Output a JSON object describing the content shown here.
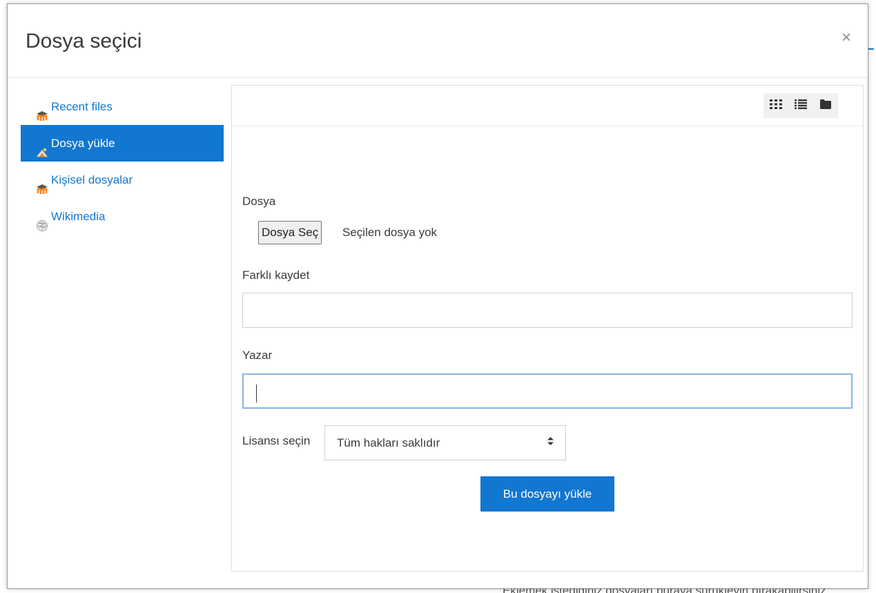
{
  "background": {
    "footer_text": "Eklemek istediğiniz dosyaları buraya sürükleyin bırakabilirsiniz"
  },
  "dialog": {
    "title": "Dosya seçici",
    "close_symbol": "×"
  },
  "sidebar": {
    "items": [
      {
        "label": "Recent files",
        "icon": "moodle-hat-icon",
        "active": false
      },
      {
        "label": "Dosya yükle",
        "icon": "upload-cloud-icon",
        "active": true
      },
      {
        "label": "Kişisel dosyalar",
        "icon": "moodle-hat-icon",
        "active": false
      },
      {
        "label": "Wikimedia",
        "icon": "wikimedia-globe-icon",
        "active": false
      }
    ]
  },
  "toolbar": {
    "view_icons": [
      "grid-view-icon",
      "list-view-icon",
      "folder-view-icon"
    ]
  },
  "form": {
    "file_label": "Dosya",
    "file_button": "Dosya Seç",
    "no_file_text": "Seçilen dosya yok",
    "save_as_label": "Farklı kaydet",
    "save_as_value": "",
    "author_label": "Yazar",
    "author_value": "",
    "license_label": "Lisansı seçin",
    "license_selected": "Tüm hakları saklıdır",
    "upload_button": "Bu dosyayı yükle"
  },
  "colors": {
    "accent": "#1177d1",
    "text": "#373a3c",
    "moodle_orange": "#f98012"
  }
}
